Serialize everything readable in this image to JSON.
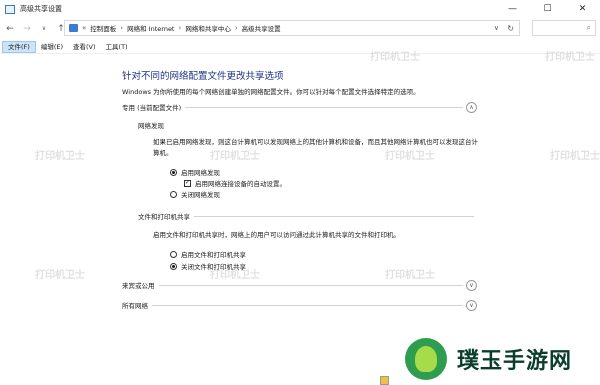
{
  "window": {
    "title": "高级共享设置",
    "controls": [
      "—",
      "☐",
      "✕"
    ]
  },
  "address": {
    "breadcrumbs": [
      "控制面板",
      "网络和 Internet",
      "网络和共享中心",
      "高级共享设置"
    ],
    "sep": "›",
    "prefix_sep": "«"
  },
  "menu": [
    "文件(F)",
    "编辑(E)",
    "查看(V)",
    "工具(T)"
  ],
  "main": {
    "heading": "针对不同的网络配置文件更改共享选项",
    "description": "Windows 为你所使用的每个网络创建单独的网络配置文件。你可以针对每个配置文件选择特定的选项。",
    "private_profile": {
      "label": "专用 (当前配置文件)",
      "discovery": {
        "title": "网络发现",
        "text": "如果已启用网络发现，则这台计算机可以发现网络上的其他计算机和设备，而且其他网络计算机也可以发现这台计算机。",
        "on_label": "启用网络发现",
        "auto_label": "启用网络连接设备的自动设置。",
        "off_label": "关闭网络发现"
      },
      "sharing": {
        "title": "文件和打印机共享",
        "text": "启用文件和打印机共享时，网络上的用户可以访问通过此计算机共享的文件和打印机。",
        "on_label": "启用文件和打印机共享",
        "off_label": "关闭文件和打印机共享"
      }
    },
    "guest_profile": {
      "label": "来宾或公用"
    },
    "all_networks": {
      "label": "所有网络"
    }
  },
  "watermark": "打印机卫士",
  "brand": {
    "name": "璞玉手游网"
  },
  "state": {
    "discovery": "on",
    "auto_setup": true,
    "sharing": "off"
  },
  "colors": {
    "heading": "#1e3287",
    "menu_active": "#cce4f7",
    "brand_text": "#0b3d2c"
  }
}
